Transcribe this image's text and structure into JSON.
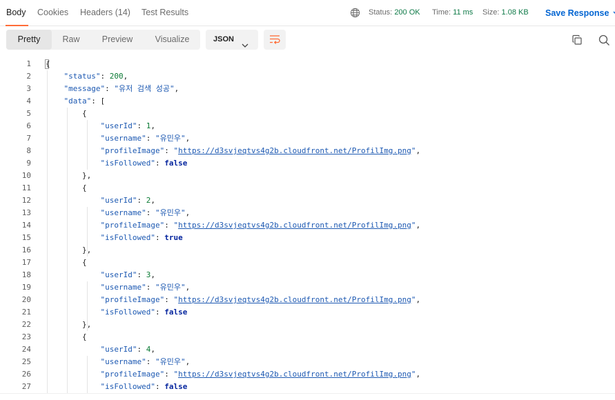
{
  "tabs": [
    {
      "label": "Body"
    },
    {
      "label": "Cookies"
    },
    {
      "label": "Headers (14)"
    },
    {
      "label": "Test Results"
    }
  ],
  "status": {
    "status_label": "Status:",
    "status_value": "200 OK",
    "time_label": "Time:",
    "time_value": "11 ms",
    "size_label": "Size:",
    "size_value": "1.08 KB"
  },
  "save_response_label": "Save Response",
  "view_modes": [
    {
      "label": "Pretty"
    },
    {
      "label": "Raw"
    },
    {
      "label": "Preview"
    },
    {
      "label": "Visualize"
    }
  ],
  "format_label": "JSON",
  "colors": {
    "accent": "#ff6c37",
    "link": "#0265d2",
    "status_ok": "#0f7a48"
  },
  "code": {
    "line_numbers": [
      "1",
      "2",
      "3",
      "4",
      "5",
      "6",
      "7",
      "8",
      "9",
      "10",
      "11",
      "12",
      "13",
      "14",
      "15",
      "16",
      "17",
      "18",
      "19",
      "20",
      "21",
      "22",
      "23",
      "24",
      "25",
      "26",
      "27"
    ],
    "status_key": "\"status\"",
    "status_val": "200",
    "message_key": "\"message\"",
    "message_val": "\"유저 검색 성공\"",
    "data_key": "\"data\"",
    "users": [
      {
        "userId": "1",
        "username": "\"유민우\"",
        "profileImage": "https://d3svjeqtvs4g2b.cloudfront.net/ProfilImg.png",
        "isFollowed": "false"
      },
      {
        "userId": "2",
        "username": "\"유민우\"",
        "profileImage": "https://d3svjeqtvs4g2b.cloudfront.net/ProfilImg.png",
        "isFollowed": "true"
      },
      {
        "userId": "3",
        "username": "\"유민우\"",
        "profileImage": "https://d3svjeqtvs4g2b.cloudfront.net/ProfilImg.png",
        "isFollowed": "false"
      },
      {
        "userId": "4",
        "username": "\"유민우\"",
        "profileImage": "https://d3svjeqtvs4g2b.cloudfront.net/ProfilImg.png",
        "isFollowed": "false"
      }
    ],
    "k_userId": "\"userId\"",
    "k_username": "\"username\"",
    "k_profileImage": "\"profileImage\"",
    "k_isFollowed": "\"isFollowed\""
  }
}
